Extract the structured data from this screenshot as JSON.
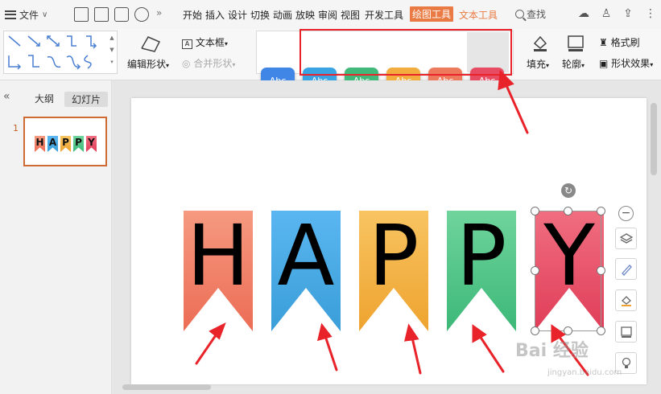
{
  "menubar": {
    "file_label": "文件",
    "more_label": "»",
    "tabs": [
      {
        "label": "开始"
      },
      {
        "label": "插入"
      },
      {
        "label": "设计"
      },
      {
        "label": "切换"
      },
      {
        "label": "动画"
      },
      {
        "label": "放映"
      },
      {
        "label": "审阅"
      },
      {
        "label": "视图"
      },
      {
        "label": "开发工具"
      },
      {
        "label": "绘图工具"
      },
      {
        "label": "文本工具"
      }
    ],
    "search_label": "查找"
  },
  "ribbon": {
    "edit_shape_label": "编辑形状",
    "textbox_label": "文本框",
    "merge_shape_label": "合并形状",
    "style_swatches": [
      {
        "label": "Abc",
        "color": "#3f86e6"
      },
      {
        "label": "Abc",
        "color": "#3aa3e3"
      },
      {
        "label": "Abc",
        "color": "#41b97a"
      },
      {
        "label": "Abc",
        "color": "#f2ad3e"
      },
      {
        "label": "Abc",
        "color": "#ee7a5d"
      },
      {
        "label": "Abc",
        "color": "#e84c62"
      }
    ],
    "fill_label": "填充",
    "outline_label": "轮廓",
    "format_painter_label": "格式刷",
    "shape_effect_label": "形状效果"
  },
  "left_panel": {
    "collapse_glyph": "«",
    "tab_outline": "大纲",
    "tab_slides": "幻灯片",
    "slide_number": "1"
  },
  "slide": {
    "flags": [
      {
        "letter": "H",
        "color_top": "#f59a80",
        "color_bottom": "#ec6c55"
      },
      {
        "letter": "A",
        "color_top": "#5ab6f0",
        "color_bottom": "#3a9ed8"
      },
      {
        "letter": "P",
        "color_top": "#f8c461",
        "color_bottom": "#eea32f"
      },
      {
        "letter": "P",
        "color_top": "#6fd49c",
        "color_bottom": "#3cb877"
      },
      {
        "letter": "Y",
        "color_top": "#f06e80",
        "color_bottom": "#e03d58"
      }
    ]
  },
  "watermark": {
    "main": "Bai 经验",
    "sub": "jingyan.baidu.com"
  },
  "colors": {
    "accent_orange": "#e97a43",
    "highlight_red": "#e8232a"
  }
}
